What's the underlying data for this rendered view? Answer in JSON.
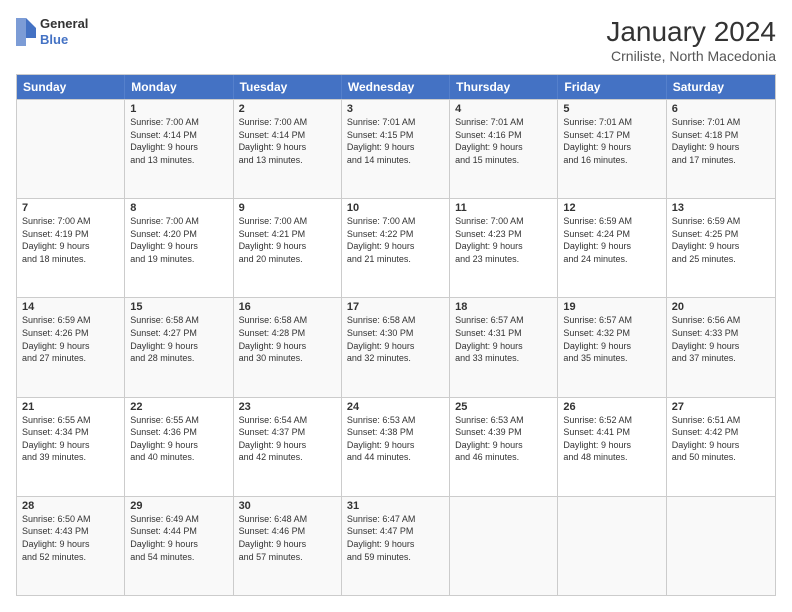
{
  "header": {
    "logo": {
      "general": "General",
      "blue": "Blue"
    },
    "title": "January 2024",
    "subtitle": "Crniliste, North Macedonia"
  },
  "days_of_week": [
    "Sunday",
    "Monday",
    "Tuesday",
    "Wednesday",
    "Thursday",
    "Friday",
    "Saturday"
  ],
  "weeks": [
    [
      {
        "day": "",
        "info": ""
      },
      {
        "day": "1",
        "info": "Sunrise: 7:00 AM\nSunset: 4:14 PM\nDaylight: 9 hours\nand 13 minutes."
      },
      {
        "day": "2",
        "info": "Sunrise: 7:00 AM\nSunset: 4:14 PM\nDaylight: 9 hours\nand 13 minutes."
      },
      {
        "day": "3",
        "info": "Sunrise: 7:01 AM\nSunset: 4:15 PM\nDaylight: 9 hours\nand 14 minutes."
      },
      {
        "day": "4",
        "info": "Sunrise: 7:01 AM\nSunset: 4:16 PM\nDaylight: 9 hours\nand 15 minutes."
      },
      {
        "day": "5",
        "info": "Sunrise: 7:01 AM\nSunset: 4:17 PM\nDaylight: 9 hours\nand 16 minutes."
      },
      {
        "day": "6",
        "info": "Sunrise: 7:01 AM\nSunset: 4:18 PM\nDaylight: 9 hours\nand 17 minutes."
      }
    ],
    [
      {
        "day": "7",
        "info": "Sunrise: 7:00 AM\nSunset: 4:19 PM\nDaylight: 9 hours\nand 18 minutes."
      },
      {
        "day": "8",
        "info": "Sunrise: 7:00 AM\nSunset: 4:20 PM\nDaylight: 9 hours\nand 19 minutes."
      },
      {
        "day": "9",
        "info": "Sunrise: 7:00 AM\nSunset: 4:21 PM\nDaylight: 9 hours\nand 20 minutes."
      },
      {
        "day": "10",
        "info": "Sunrise: 7:00 AM\nSunset: 4:22 PM\nDaylight: 9 hours\nand 21 minutes."
      },
      {
        "day": "11",
        "info": "Sunrise: 7:00 AM\nSunset: 4:23 PM\nDaylight: 9 hours\nand 23 minutes."
      },
      {
        "day": "12",
        "info": "Sunrise: 6:59 AM\nSunset: 4:24 PM\nDaylight: 9 hours\nand 24 minutes."
      },
      {
        "day": "13",
        "info": "Sunrise: 6:59 AM\nSunset: 4:25 PM\nDaylight: 9 hours\nand 25 minutes."
      }
    ],
    [
      {
        "day": "14",
        "info": "Sunrise: 6:59 AM\nSunset: 4:26 PM\nDaylight: 9 hours\nand 27 minutes."
      },
      {
        "day": "15",
        "info": "Sunrise: 6:58 AM\nSunset: 4:27 PM\nDaylight: 9 hours\nand 28 minutes."
      },
      {
        "day": "16",
        "info": "Sunrise: 6:58 AM\nSunset: 4:28 PM\nDaylight: 9 hours\nand 30 minutes."
      },
      {
        "day": "17",
        "info": "Sunrise: 6:58 AM\nSunset: 4:30 PM\nDaylight: 9 hours\nand 32 minutes."
      },
      {
        "day": "18",
        "info": "Sunrise: 6:57 AM\nSunset: 4:31 PM\nDaylight: 9 hours\nand 33 minutes."
      },
      {
        "day": "19",
        "info": "Sunrise: 6:57 AM\nSunset: 4:32 PM\nDaylight: 9 hours\nand 35 minutes."
      },
      {
        "day": "20",
        "info": "Sunrise: 6:56 AM\nSunset: 4:33 PM\nDaylight: 9 hours\nand 37 minutes."
      }
    ],
    [
      {
        "day": "21",
        "info": "Sunrise: 6:55 AM\nSunset: 4:34 PM\nDaylight: 9 hours\nand 39 minutes."
      },
      {
        "day": "22",
        "info": "Sunrise: 6:55 AM\nSunset: 4:36 PM\nDaylight: 9 hours\nand 40 minutes."
      },
      {
        "day": "23",
        "info": "Sunrise: 6:54 AM\nSunset: 4:37 PM\nDaylight: 9 hours\nand 42 minutes."
      },
      {
        "day": "24",
        "info": "Sunrise: 6:53 AM\nSunset: 4:38 PM\nDaylight: 9 hours\nand 44 minutes."
      },
      {
        "day": "25",
        "info": "Sunrise: 6:53 AM\nSunset: 4:39 PM\nDaylight: 9 hours\nand 46 minutes."
      },
      {
        "day": "26",
        "info": "Sunrise: 6:52 AM\nSunset: 4:41 PM\nDaylight: 9 hours\nand 48 minutes."
      },
      {
        "day": "27",
        "info": "Sunrise: 6:51 AM\nSunset: 4:42 PM\nDaylight: 9 hours\nand 50 minutes."
      }
    ],
    [
      {
        "day": "28",
        "info": "Sunrise: 6:50 AM\nSunset: 4:43 PM\nDaylight: 9 hours\nand 52 minutes."
      },
      {
        "day": "29",
        "info": "Sunrise: 6:49 AM\nSunset: 4:44 PM\nDaylight: 9 hours\nand 54 minutes."
      },
      {
        "day": "30",
        "info": "Sunrise: 6:48 AM\nSunset: 4:46 PM\nDaylight: 9 hours\nand 57 minutes."
      },
      {
        "day": "31",
        "info": "Sunrise: 6:47 AM\nSunset: 4:47 PM\nDaylight: 9 hours\nand 59 minutes."
      },
      {
        "day": "",
        "info": ""
      },
      {
        "day": "",
        "info": ""
      },
      {
        "day": "",
        "info": ""
      }
    ]
  ]
}
